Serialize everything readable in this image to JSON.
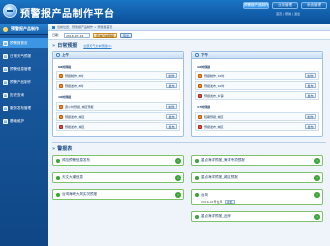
{
  "app": {
    "title": "预警报产品制作平台"
  },
  "top_tabs": [
    {
      "label": "预警报产品制作平台",
      "active": true
    },
    {
      "label": "业务管理",
      "active": false
    },
    {
      "label": "系统管理",
      "active": false
    }
  ],
  "top_links": "首页 | 帮助 | 退出",
  "sidebar": {
    "header": "预警报产品制作",
    "items": [
      {
        "label": "预警报首页",
        "active": true
      },
      {
        "label": "日常天气预报",
        "active": false
      },
      {
        "label": "预警信息管理",
        "active": false
      },
      {
        "label": "预警产品制作",
        "active": false
      },
      {
        "label": "历史查询",
        "active": false
      },
      {
        "label": "服务发布管理",
        "active": false
      },
      {
        "label": "基础维护",
        "active": false
      }
    ]
  },
  "breadcrumb": "当前位置：预警报产品制作 > 预警报首页",
  "filter": {
    "date_label": "日期：",
    "date_value": "2016-07-16",
    "search_button": "查询日常预报",
    "export_button": "导出"
  },
  "daily": {
    "title": "日常预报",
    "link": "全部天气文本预报(0)",
    "morning": {
      "title": "上午",
      "rows": [
        {
          "text": "08时预报",
          "kind": "header",
          "button": ""
        },
        {
          "text": "预报制作_8时",
          "kind": "warn",
          "button": "制作"
        },
        {
          "text": "预报发布_8时",
          "kind": "warn",
          "button": "发布"
        },
        {
          "text": "10时预报",
          "kind": "header",
          "button": ""
        },
        {
          "text": "逐小时预报_城区预报",
          "kind": "warn",
          "button": "制作"
        },
        {
          "text": "预报发布_城区",
          "kind": "warn",
          "button": "发布"
        },
        {
          "text": "预报发布_城区",
          "kind": "del",
          "button": "发布"
        }
      ]
    },
    "afternoon": {
      "title": "下午",
      "rows": [
        {
          "text": "16时预报",
          "kind": "header",
          "button": ""
        },
        {
          "text": "预报制作_16时",
          "kind": "warn",
          "button": "制作"
        },
        {
          "text": "预报发布_16时",
          "kind": "warn",
          "button": "发布"
        },
        {
          "text": "预报发布_乡镇",
          "kind": "del",
          "button": "发布"
        },
        {
          "text": "17时预报",
          "kind": "header",
          "button": ""
        },
        {
          "text": "短期预报_城区",
          "kind": "warn",
          "button": "制作"
        },
        {
          "text": "预报发布_城区",
          "kind": "del",
          "button": "发布"
        }
      ]
    }
  },
  "alerts": {
    "title": "警报表",
    "left": [
      {
        "label": "风险预警信息发布"
      },
      {
        "label": "天文大潮信息"
      },
      {
        "label": "台湾海峡大风实况预报"
      }
    ],
    "right": [
      {
        "label": "重点海洋预报_海洋专项预报"
      },
      {
        "label": "重点海洋预报_城区预报"
      },
      {
        "label": "台风",
        "sub": "2016-01号台风",
        "button": "查看"
      },
      {
        "label": "重点海洋预报_近岸"
      }
    ]
  },
  "colors": {
    "header": "#0b4f98",
    "sidebar": "#1b5ea6",
    "accent": "#2f7ec9",
    "alert_green": "#3aa435",
    "warn_orange": "#f08a22"
  }
}
